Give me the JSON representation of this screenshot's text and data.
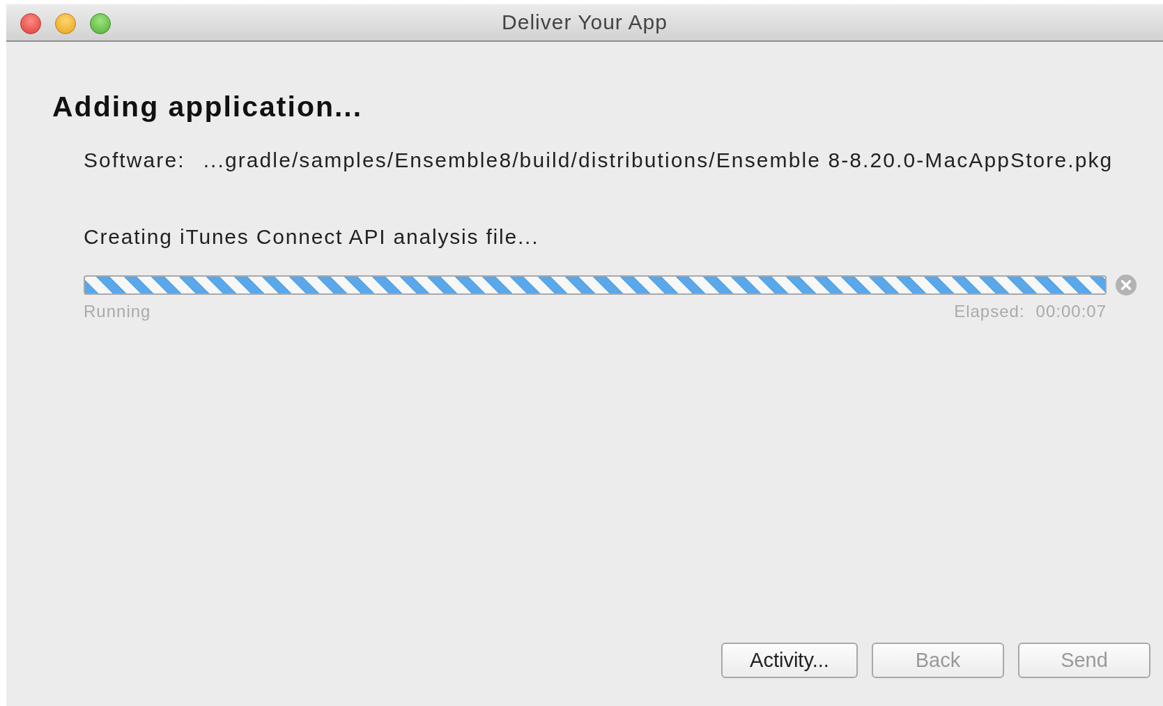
{
  "window": {
    "title": "Deliver Your App"
  },
  "heading": "Adding application...",
  "software": {
    "label": "Software:",
    "value": "...gradle/samples/Ensemble8/build/distributions/Ensemble 8-8.20.0-MacAppStore.pkg"
  },
  "task": "Creating iTunes Connect API analysis file...",
  "progress": {
    "indeterminate": true,
    "status": "Running",
    "elapsed_label": "Elapsed:",
    "elapsed": "00:00:07"
  },
  "buttons": [
    {
      "label": "Activity...",
      "disabled": false
    },
    {
      "label": "Back",
      "disabled": true
    },
    {
      "label": "Send",
      "disabled": true
    }
  ]
}
